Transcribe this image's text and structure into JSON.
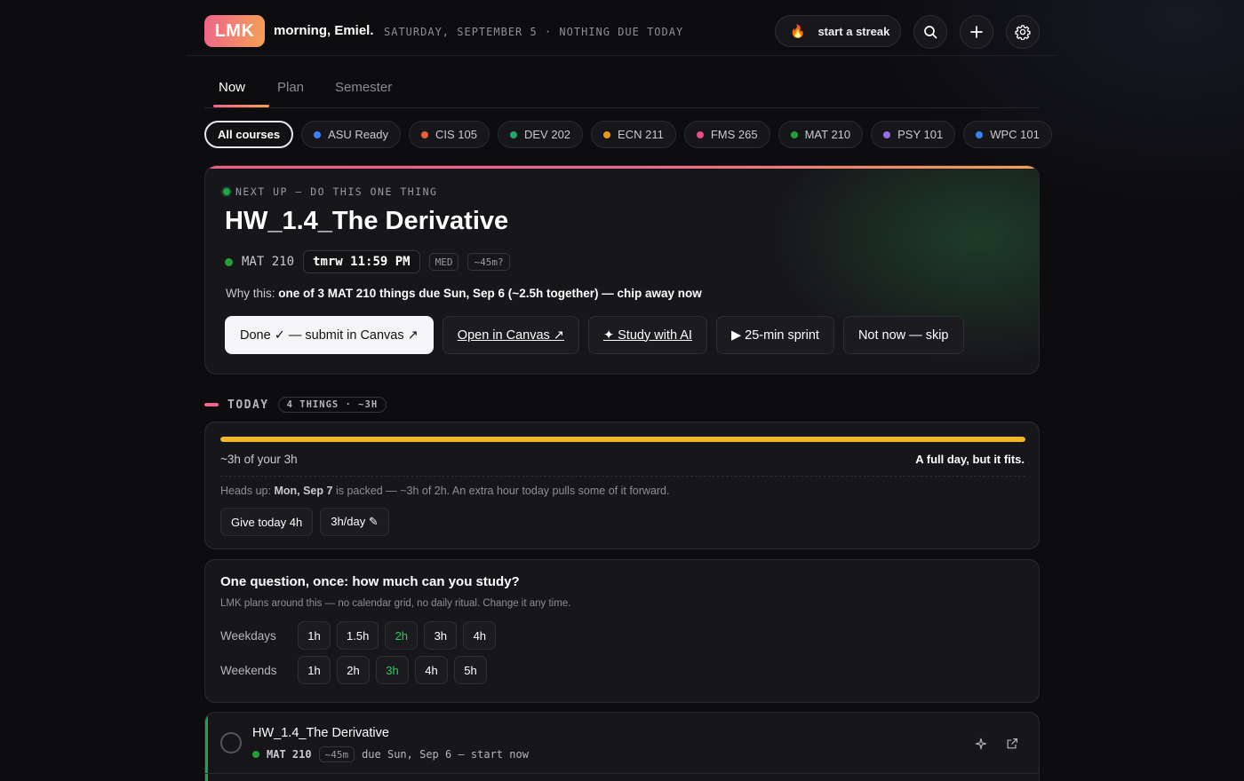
{
  "header": {
    "logo": "LMK",
    "greeting": "morning, Emiel.",
    "dateline": "SATURDAY, SEPTEMBER 5 · NOTHING DUE TODAY",
    "streak_label": "start a streak"
  },
  "tabs": [
    {
      "label": "Now"
    },
    {
      "label": "Plan"
    },
    {
      "label": "Semester"
    }
  ],
  "courses": [
    {
      "label": "All courses"
    },
    {
      "label": "ASU Ready",
      "color": "#3b82f6"
    },
    {
      "label": "CIS 105",
      "color": "#e5623a"
    },
    {
      "label": "DEV 202",
      "color": "#1ea86a"
    },
    {
      "label": "ECN 211",
      "color": "#e69a17"
    },
    {
      "label": "FMS 265",
      "color": "#e44d86"
    },
    {
      "label": "MAT 210",
      "color": "#22a035"
    },
    {
      "label": "PSY 101",
      "color": "#9b6ee8"
    },
    {
      "label": "WPC 101",
      "color": "#3b82f6"
    }
  ],
  "next_up": {
    "eyebrow": "NEXT UP — DO THIS ONE THING",
    "title": "HW_1.4_The Derivative",
    "course": "MAT 210",
    "course_color": "#22a035",
    "due": "tmrw 11:59 PM",
    "difficulty": "MED",
    "estimate": "~45m?",
    "why_prefix": "Why this:",
    "why_text": "one of 3 MAT 210 things due Sun, Sep 6 (~2.5h together) — chip away now",
    "actions": {
      "done": "Done ✓ — submit in Canvas ↗",
      "open": "Open in Canvas ↗",
      "study": "✦ Study with AI",
      "sprint": "▶ 25-min sprint",
      "skip": "Not now — skip"
    }
  },
  "today": {
    "label": "TODAY",
    "count": "4 THINGS · ~3H",
    "budget_used": "~3h of your 3h",
    "budget_fill": 1.0,
    "budget_verdict": "A full day, but it fits.",
    "headsup_prefix": "Heads up:",
    "headsup_day": "Mon, Sep 7",
    "headsup_text": "is packed — ~3h of 2h. An extra hour today pulls some of it forward.",
    "btn_give": "Give today 4h",
    "btn_perday": "3h/day ✎"
  },
  "study": {
    "question": "One question, once: how much can you study?",
    "subtitle": "LMK plans around this — no calendar grid, no daily ritual. Change it any time.",
    "weekdays_label": "Weekdays",
    "weekdays": [
      "1h",
      "1.5h",
      "2h",
      "3h",
      "4h"
    ],
    "weekdays_selected": "2h",
    "weekends_label": "Weekends",
    "weekends": [
      "1h",
      "2h",
      "3h",
      "4h",
      "5h"
    ],
    "weekends_selected": "3h"
  },
  "task": {
    "title": "HW_1.4_The Derivative",
    "course": "MAT 210",
    "estimate": "~45m",
    "due": "due Sun, Sep 6 — start now"
  },
  "colors": {
    "accent_start": "#f0648c",
    "accent_end": "#f4a253",
    "progress": "#f2b52a",
    "selected": "#2ecb5c"
  }
}
